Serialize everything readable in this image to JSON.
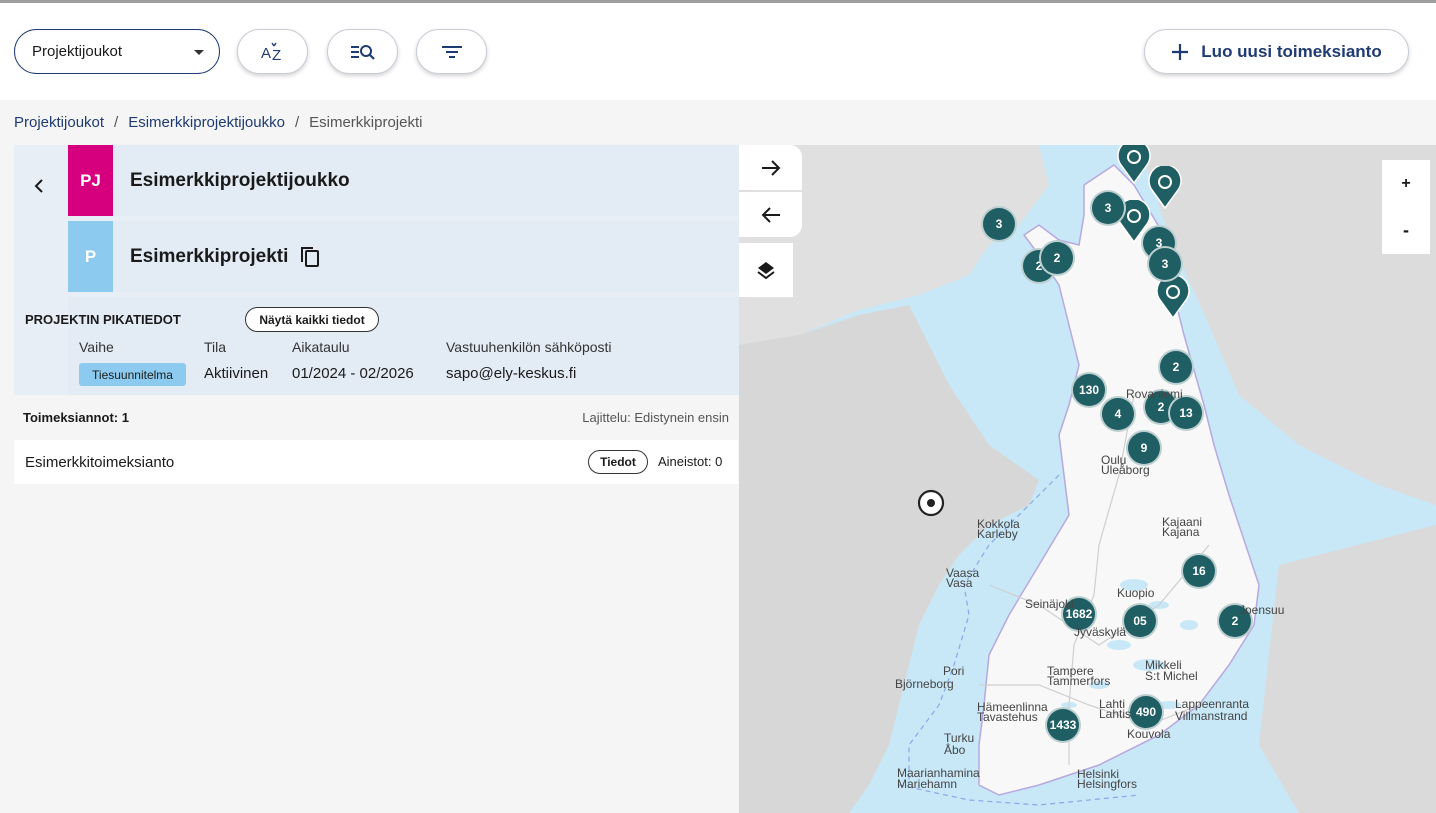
{
  "toolbar": {
    "select_value": "Projektijoukot",
    "sort_icon": "sort-az-icon",
    "search_icon": "list-search-icon",
    "filter_icon": "filter-icon",
    "new_assignment_label": "Luo uusi toimeksianto"
  },
  "breadcrumb": {
    "items": [
      "Projektijoukot",
      "Esimerkkiprojektijoukko",
      "Esimerkkiprojekti"
    ],
    "separator": "/"
  },
  "project_group": {
    "badge": "PJ",
    "name": "Esimerkkiprojektijoukko",
    "color": "#d6007e"
  },
  "project": {
    "badge": "P",
    "name": "Esimerkkiprojekti",
    "color": "#8ccbef"
  },
  "quick_info": {
    "title": "PROJEKTIN PIKATIEDOT",
    "show_all_label": "Näytä kaikki tiedot",
    "labels": {
      "stage": "Vaihe",
      "status": "Tila",
      "schedule": "Aikataulu",
      "email": "Vastuuhenkilön sähköposti"
    },
    "values": {
      "stage": "Tiesuunnitelma",
      "status": "Aktiivinen",
      "schedule": "01/2024 - 02/2026",
      "email": "sapo@ely-keskus.fi"
    }
  },
  "assignments": {
    "count_label": "Toimeksiannot: 1",
    "sort_label": "Lajittelu: Edistynein ensin",
    "items": [
      {
        "name": "Esimerkkitoimeksianto",
        "details_label": "Tiedot",
        "materials": "Aineistot: 0"
      }
    ]
  },
  "map": {
    "zoom_in": "+",
    "zoom_out": "-",
    "clusters": [
      "3",
      "3",
      "3",
      "3",
      "2",
      "2",
      "130",
      "2",
      "4",
      "2",
      "13",
      "9",
      "16",
      "1682",
      "05",
      "2",
      "490",
      "1433"
    ],
    "cities": [
      "Rovaniemi",
      "Oulu",
      "Uleåborg",
      "Kokkola",
      "Karleby",
      "Kajaani",
      "Kajana",
      "Vaasa",
      "Vasa",
      "Kuopio",
      "Seinäjoki",
      "Jyväskylä",
      "Pori",
      "Björneborg",
      "Tampere",
      "Tammerfors",
      "Mikkeli",
      "S:t Michel",
      "Lappeenranta",
      "Villmanstrand",
      "Hämeenlinna",
      "Tavastehus",
      "Lahti",
      "Lahtis",
      "Kouvola",
      "Turku",
      "Åbo",
      "Maarianhamina",
      "Mariehamn",
      "Helsinki",
      "Helsingfors",
      "Joensuu"
    ]
  }
}
